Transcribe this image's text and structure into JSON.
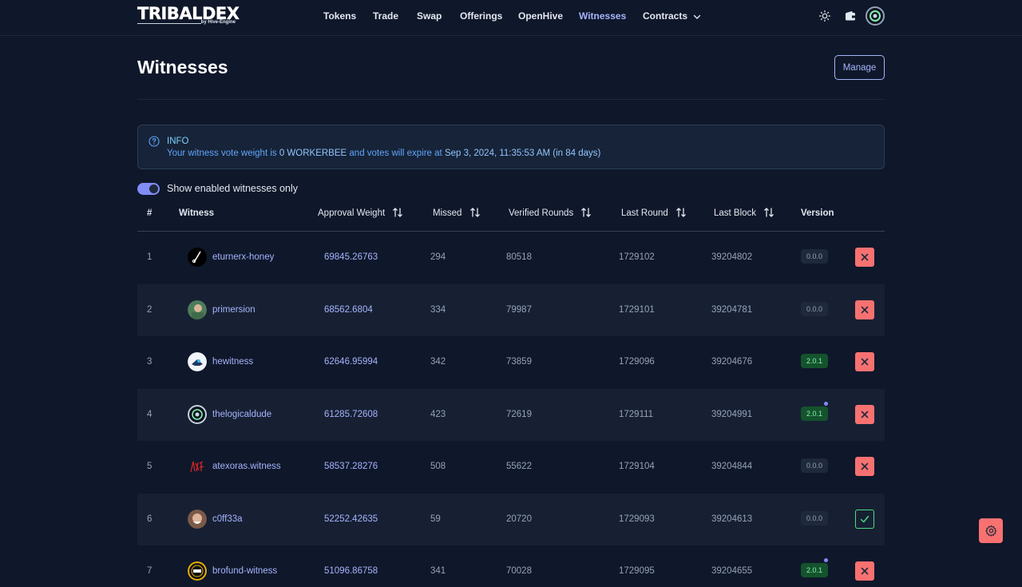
{
  "brand": {
    "name": "TRIBALDEX",
    "sub": "by Hive-Engine"
  },
  "nav": {
    "items": [
      {
        "label": "Tokens"
      },
      {
        "label": "Trade"
      },
      {
        "label": "Swap"
      },
      {
        "label": "Offerings"
      },
      {
        "label": "OpenHive"
      },
      {
        "label": "Witnesses",
        "active": true
      },
      {
        "label": "Contracts"
      }
    ]
  },
  "header_icons": [
    "sun-icon",
    "wallet-icon",
    "user-avatar"
  ],
  "page": {
    "title": "Witnesses",
    "manage_label": "Manage"
  },
  "info": {
    "title": "INFO",
    "text_pre": "Your witness vote weight is ",
    "weight": "0 WORKERBEE",
    "text_mid": " and votes will expire at ",
    "expiry": "Sep 3, 2024, 11:35:53 AM (in 84 days)",
    "text_post": ")"
  },
  "toggle": {
    "label": "Show enabled witnesses only",
    "on": true
  },
  "table": {
    "columns": {
      "rank": "#",
      "witness": "Witness",
      "approval": "Approval Weight",
      "missed": "Missed",
      "verified": "Verified Rounds",
      "last_round": "Last Round",
      "last_block": "Last Block",
      "version": "Version"
    },
    "rows": [
      {
        "rank": "1",
        "witness": "eturnerx-honey",
        "approval": "69845.26763",
        "missed": "294",
        "verified": "80518",
        "last_round": "1729102",
        "last_block": "39204802",
        "version": "0.0.0",
        "version_ok": false,
        "voted": false
      },
      {
        "rank": "2",
        "witness": "primersion",
        "approval": "68562.6804",
        "missed": "334",
        "verified": "79987",
        "last_round": "1729101",
        "last_block": "39204781",
        "version": "0.0.0",
        "version_ok": false,
        "voted": false
      },
      {
        "rank": "3",
        "witness": "hewitness",
        "approval": "62646.95994",
        "missed": "342",
        "verified": "73859",
        "last_round": "1729096",
        "last_block": "39204676",
        "version": "2.0.1",
        "version_ok": true,
        "voted": false
      },
      {
        "rank": "4",
        "witness": "thelogicaldude",
        "approval": "61285.72608",
        "missed": "423",
        "verified": "72619",
        "last_round": "1729111",
        "last_block": "39204991",
        "version": "2.0.1",
        "version_ok": true,
        "voted": false
      },
      {
        "rank": "5",
        "witness": "atexoras.witness",
        "approval": "58537.28276",
        "missed": "508",
        "verified": "55622",
        "last_round": "1729104",
        "last_block": "39204844",
        "version": "0.0.0",
        "version_ok": false,
        "voted": false
      },
      {
        "rank": "6",
        "witness": "c0ff33a",
        "approval": "52252.42635",
        "missed": "59",
        "verified": "20720",
        "last_round": "1729093",
        "last_block": "39204613",
        "version": "0.0.0",
        "version_ok": false,
        "voted": true
      },
      {
        "rank": "7",
        "witness": "brofund-witness",
        "approval": "51096.86758",
        "missed": "341",
        "verified": "70028",
        "last_round": "1729095",
        "last_block": "39204655",
        "version": "2.0.1",
        "version_ok": true,
        "voted": false
      }
    ]
  },
  "colors": {
    "background": "#0f172a",
    "accent": "#a5b4fc",
    "danger": "#f87171",
    "success": "#4ade80"
  }
}
